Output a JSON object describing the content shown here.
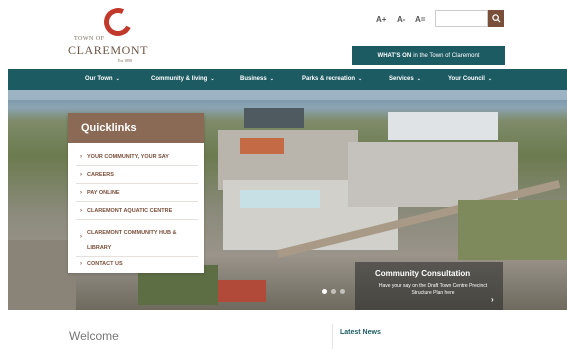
{
  "header": {
    "logo": {
      "town_of": "TOWN OF",
      "name": "CLAREMONT",
      "est": "Est 1898"
    },
    "font_controls": [
      "A+",
      "A-",
      "A="
    ],
    "search": {
      "placeholder": ""
    },
    "whats_on": {
      "strong": "WHAT'S ON",
      "rest": "in the Town of Claremont"
    }
  },
  "nav": {
    "items": [
      {
        "label": "Our Town"
      },
      {
        "label": "Community & living"
      },
      {
        "label": "Business"
      },
      {
        "label": "Parks & recreation"
      },
      {
        "label": "Services"
      },
      {
        "label": "Your Council"
      }
    ]
  },
  "quicklinks": {
    "title": "Quicklinks",
    "items": [
      "YOUR COMMUNITY, YOUR SAY",
      "CAREERS",
      "PAY ONLINE",
      "CLAREMONT AQUATIC CENTRE",
      "CLAREMONT COMMUNITY HUB & LIBRARY",
      "CONTACT US"
    ]
  },
  "consultation": {
    "title": "Community Consultation",
    "text": "Have your say on the Draft Town Centre Precinct Structure Plan here",
    "arrow": "›"
  },
  "carousel": {
    "slides": 3,
    "active_index": 0
  },
  "sections": {
    "welcome": "Welcome",
    "latest_news": "Latest News"
  },
  "colors": {
    "brand_teal": "#1d5b63",
    "brand_brown": "#7a4f3a",
    "logo_red": "#c0392b"
  }
}
